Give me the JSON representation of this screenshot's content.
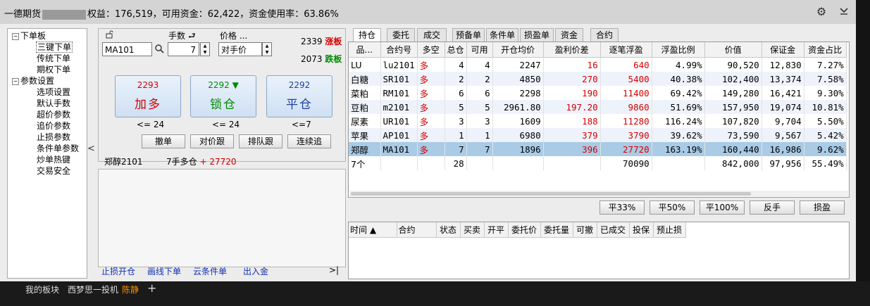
{
  "titlebar": {
    "broker": "一德期货",
    "equity_text": "权益：176,519，可用资金：62,422，资金使用率：63.86%",
    "settings_icon": "gear-icon",
    "dropdown_icon": "chevron-down-icon"
  },
  "tree": {
    "root1": "下单板",
    "children1": [
      "三键下单",
      "传统下单",
      "期权下单"
    ],
    "root2": "参数设置",
    "children2": [
      "选项设置",
      "默认手数",
      "超价参数",
      "追价参数",
      "止损参数",
      "条件单参数",
      "炒单热键",
      "交易安全"
    ],
    "collapse_glyph": "<"
  },
  "order": {
    "lock_icon": "lock-icon",
    "contract": "MA101",
    "search_icon": "search-icon",
    "lots_label": "手数",
    "lots_value": "7",
    "price_label": "价格",
    "price_more": "...",
    "price_value": "对手价",
    "limit_up_price": "2339",
    "limit_up_label": "涨板",
    "limit_down_price": "2073",
    "limit_down_label": "跌板",
    "buttons": [
      {
        "price": "2293",
        "label": "加多",
        "sub": "<= 24"
      },
      {
        "price": "2292",
        "arrow": "▼",
        "label": "锁仓",
        "sub": "<= 24"
      },
      {
        "price": "2292",
        "label": "平仓",
        "sub": "<=7"
      }
    ],
    "small_buttons": [
      "撤单",
      "对价跟",
      "排队跟",
      "连续追"
    ],
    "pos_contract": "郑醇2101",
    "pos_desc": "7手多仓",
    "pos_pnl": "+ 27720",
    "links": [
      "止损开仓",
      "画线下单",
      "云条件单",
      "出入金"
    ],
    "links_more": ">|"
  },
  "tabs": [
    "持仓",
    "委托",
    "成交",
    "预备单",
    "条件单",
    "损盈单",
    "资金",
    "合约"
  ],
  "positions": {
    "columns": [
      "品...",
      "合约号",
      "多空",
      "总仓",
      "可用",
      "开仓均价",
      "盈利价差",
      "逐笔浮盈",
      "浮盈比例",
      "价值",
      "保证金",
      "资金占比"
    ],
    "sort_arrow": "▲",
    "rows": [
      [
        "LU",
        "lu2101",
        "多",
        "4",
        "4",
        "2247",
        "16",
        "640",
        "4.99%",
        "90,520",
        "12,830",
        "7.27%"
      ],
      [
        "白糖",
        "SR101",
        "多",
        "2",
        "2",
        "4850",
        "270",
        "5400",
        "40.38%",
        "102,400",
        "13,374",
        "7.58%"
      ],
      [
        "菜粕",
        "RM101",
        "多",
        "6",
        "6",
        "2298",
        "190",
        "11400",
        "69.42%",
        "149,280",
        "16,421",
        "9.30%"
      ],
      [
        "豆粕",
        "m2101",
        "多",
        "5",
        "5",
        "2961.80",
        "197.20",
        "9860",
        "51.69%",
        "157,950",
        "19,074",
        "10.81%"
      ],
      [
        "尿素",
        "UR101",
        "多",
        "3",
        "3",
        "1609",
        "188",
        "11280",
        "116.24%",
        "107,820",
        "9,704",
        "5.50%"
      ],
      [
        "苹果",
        "AP101",
        "多",
        "1",
        "1",
        "6980",
        "379",
        "3790",
        "39.62%",
        "73,590",
        "9,567",
        "5.42%"
      ],
      [
        "郑醇",
        "MA101",
        "多",
        "7",
        "7",
        "1896",
        "396",
        "27720",
        "163.19%",
        "160,440",
        "16,986",
        "9.62%"
      ]
    ],
    "total": [
      "7个",
      "",
      "",
      "28",
      "",
      "",
      "",
      "70090",
      "",
      "842,000",
      "97,956",
      "55.49%"
    ]
  },
  "action_buttons": [
    "平33%",
    "平50%",
    "平100%",
    "反手",
    "损盈"
  ],
  "orders": {
    "columns": [
      "时间 ▲",
      "合约",
      "状态",
      "买卖",
      "开平",
      "委托价",
      "委托量",
      "可撤",
      "已成交",
      "投保",
      "预止损"
    ]
  },
  "bottom": {
    "tabs": [
      "我的板块",
      "西梦思一投机",
      "陈静"
    ],
    "add": "+"
  },
  "colors": {
    "red": "#d40000",
    "green": "#008a00",
    "selection": "#a9cbe6",
    "accent": "#ff8c00"
  }
}
